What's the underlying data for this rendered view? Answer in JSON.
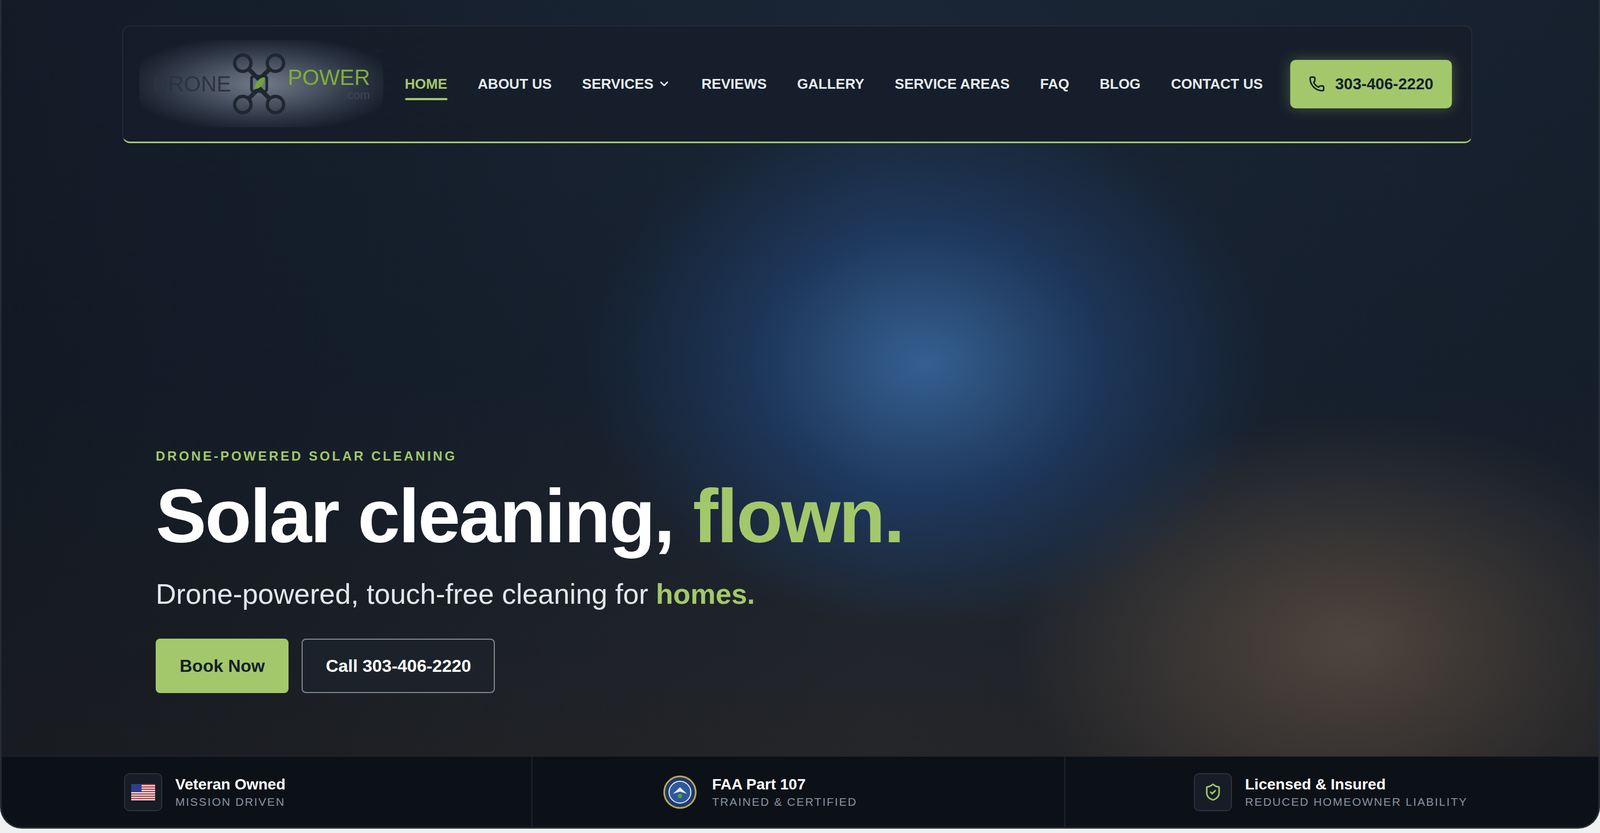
{
  "logo": {
    "left": "DRONE",
    "right": "POWER",
    "suffix": ".com",
    "mark": "™"
  },
  "nav": {
    "items": [
      {
        "label": "HOME",
        "selected": true,
        "has_menu": false
      },
      {
        "label": "ABOUT US",
        "selected": false,
        "has_menu": false
      },
      {
        "label": "SERVICES",
        "selected": false,
        "has_menu": true
      },
      {
        "label": "REVIEWS",
        "selected": false,
        "has_menu": false
      },
      {
        "label": "GALLERY",
        "selected": false,
        "has_menu": false
      },
      {
        "label": "SERVICE AREAS",
        "selected": false,
        "has_menu": false
      },
      {
        "label": "FAQ",
        "selected": false,
        "has_menu": false
      },
      {
        "label": "BLOG",
        "selected": false,
        "has_menu": false
      },
      {
        "label": "CONTACT US",
        "selected": false,
        "has_menu": false
      }
    ],
    "phone": "303-406-2220"
  },
  "hero": {
    "eyebrow": "DRONE-POWERED SOLAR CLEANING",
    "headline": "Solar cleaning,",
    "headline_accent": "flown.",
    "subtitle": "Drone-powered, touch-free cleaning for",
    "subtitle_accent": "homes.",
    "buttons": [
      {
        "label": "Book Now",
        "kind": "primary"
      },
      {
        "label": "Call 303-406-2220",
        "kind": "outline"
      }
    ]
  },
  "badges": [
    {
      "title": "Veteran Owned",
      "subtitle": "MISSION DRIVEN",
      "kind": "flag"
    },
    {
      "title": "FAA Part 107",
      "subtitle": "TRAINED & CERTIFIED",
      "kind": "seal"
    },
    {
      "title": "Licensed & Insured",
      "subtitle": "REDUCED HOMEOWNER LIABILITY",
      "kind": "shield"
    }
  ]
}
